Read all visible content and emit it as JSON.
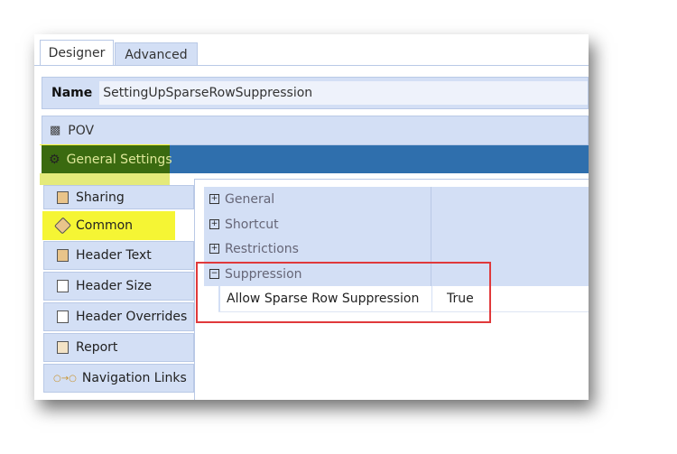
{
  "tabs": [
    {
      "label": "Designer",
      "active": true
    },
    {
      "label": "Advanced",
      "active": false
    }
  ],
  "name": {
    "label": "Name",
    "value": "SettingUpSparseRowSuppression"
  },
  "sections": {
    "pov": "POV",
    "general_settings": "General Settings"
  },
  "nav": [
    {
      "label": "Sharing",
      "icon": "sharing-icon"
    },
    {
      "label": "Common",
      "icon": "tag-icon",
      "selected": true
    },
    {
      "label": "Header Text",
      "icon": "header-text-icon"
    },
    {
      "label": "Header Size",
      "icon": "header-size-icon"
    },
    {
      "label": "Header Overrides",
      "icon": "header-overrides-icon"
    },
    {
      "label": "Report",
      "icon": "report-icon"
    },
    {
      "label": "Navigation Links",
      "icon": "navigation-links-icon"
    }
  ],
  "property_grid": {
    "categories": [
      {
        "label": "General",
        "expanded": false
      },
      {
        "label": "Shortcut",
        "expanded": false
      },
      {
        "label": "Restrictions",
        "expanded": false
      },
      {
        "label": "Suppression",
        "expanded": true
      }
    ],
    "properties": [
      {
        "name": "Allow Sparse Row Suppression",
        "value": "True"
      }
    ]
  },
  "colors": {
    "accent": "#2f6fad",
    "panel": "#d3dff5",
    "highlight": "#f5f534",
    "annotation": "#e0393b"
  }
}
